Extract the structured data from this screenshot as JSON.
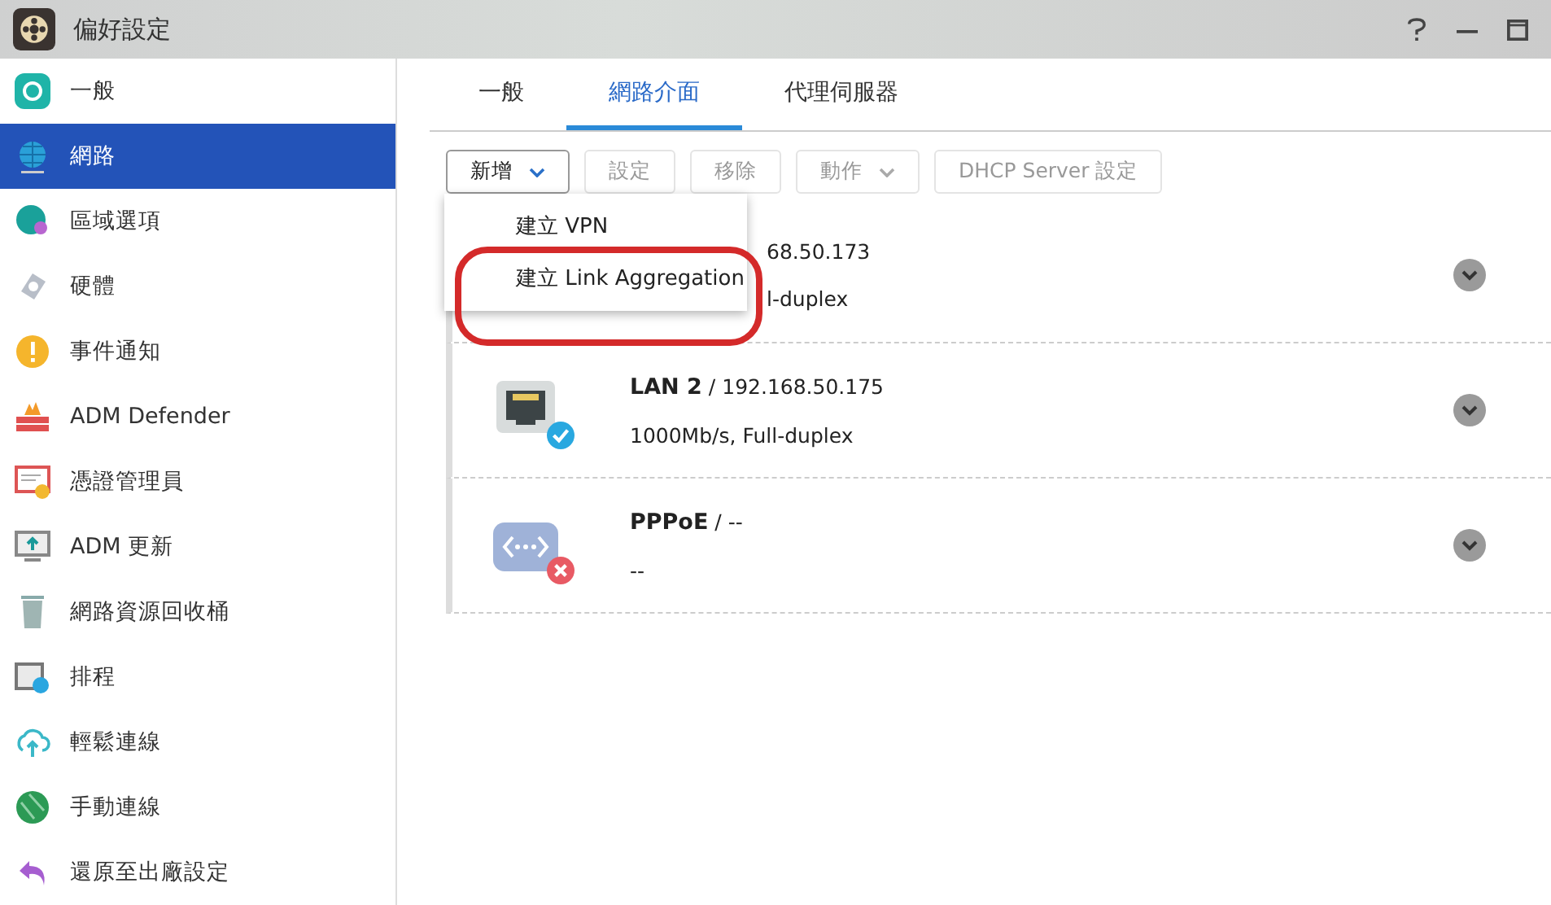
{
  "window": {
    "title": "偏好設定"
  },
  "sidebar": {
    "items": [
      {
        "label": "一般",
        "selected": false
      },
      {
        "label": "網路",
        "selected": true
      },
      {
        "label": "區域選項",
        "selected": false
      },
      {
        "label": "硬體",
        "selected": false
      },
      {
        "label": "事件通知",
        "selected": false
      },
      {
        "label": "ADM Defender",
        "selected": false
      },
      {
        "label": "憑證管理員",
        "selected": false
      },
      {
        "label": "ADM 更新",
        "selected": false
      },
      {
        "label": "網路資源回收桶",
        "selected": false
      },
      {
        "label": "排程",
        "selected": false
      },
      {
        "label": "輕鬆連線",
        "selected": false
      },
      {
        "label": "手動連線",
        "selected": false
      },
      {
        "label": "還原至出廠設定",
        "selected": false
      }
    ]
  },
  "tabs": [
    {
      "label": "一般",
      "selected": false
    },
    {
      "label": "網路介面",
      "selected": true
    },
    {
      "label": "代理伺服器",
      "selected": false
    }
  ],
  "toolbar": [
    {
      "label": "新增",
      "disabled": false,
      "dropdown": true
    },
    {
      "label": "設定",
      "disabled": true,
      "dropdown": false
    },
    {
      "label": "移除",
      "disabled": true,
      "dropdown": false
    },
    {
      "label": "動作",
      "disabled": true,
      "dropdown": true
    },
    {
      "label": "DHCP Server 設定",
      "disabled": true,
      "dropdown": false
    }
  ],
  "add_menu": {
    "items": [
      {
        "label": "建立 VPN",
        "highlighted": false
      },
      {
        "label": "建立 Link Aggregation",
        "highlighted": true
      }
    ]
  },
  "interfaces": [
    {
      "kind": "hidden",
      "title": "68.50.173",
      "speed": "l-duplex"
    },
    {
      "kind": "ethernet",
      "connected": true,
      "title": "**LAN 2** / 192.168.50.175",
      "speed": "1000Mb/s, Full-duplex"
    },
    {
      "kind": "pppoe",
      "connected": false,
      "title": "**PPPoE** / --",
      "speed": "--"
    }
  ]
}
